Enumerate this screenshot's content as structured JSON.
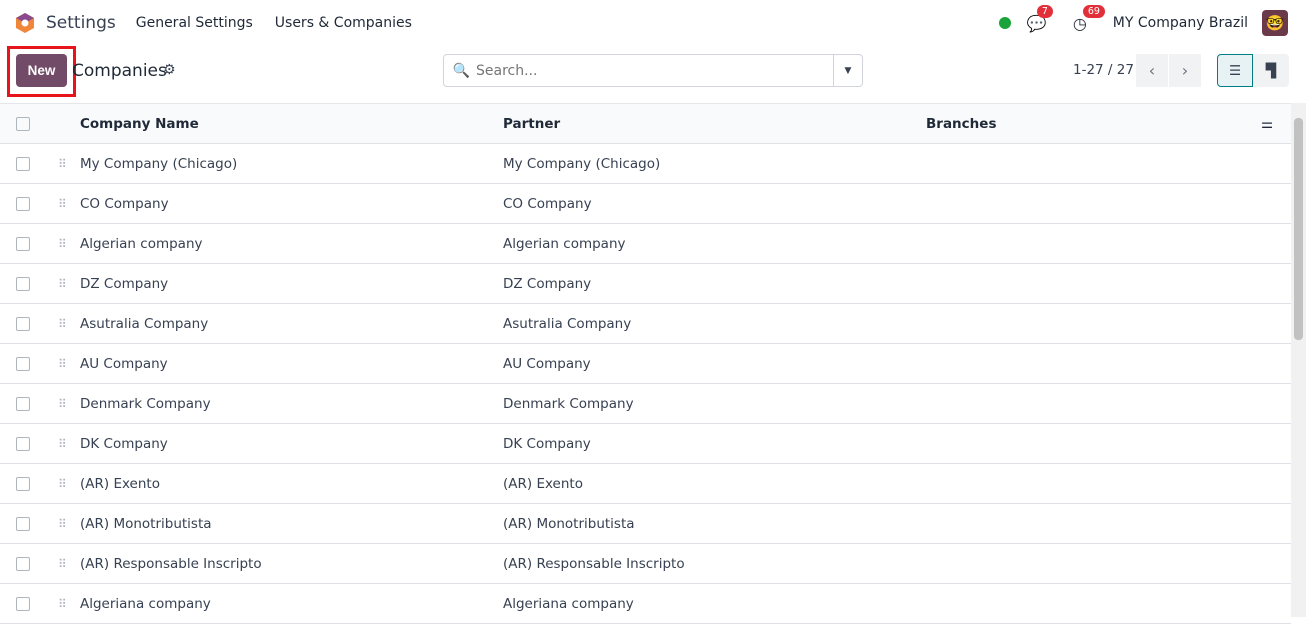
{
  "navbar": {
    "app": "Settings",
    "menus": [
      "General Settings",
      "Users & Companies"
    ],
    "messages_count": "7",
    "activities_count": "69",
    "company": "MY Company Brazil",
    "status_color": "#1aa33a"
  },
  "control": {
    "new_label": "New",
    "title": "Companies",
    "search_placeholder": "Search...",
    "pager": "1-27 / 27"
  },
  "table": {
    "headers": [
      "Company Name",
      "Partner",
      "Branches"
    ],
    "rows": [
      [
        "My Company (Chicago)",
        "My Company (Chicago)"
      ],
      [
        "CO Company",
        "CO Company"
      ],
      [
        "Algerian company",
        "Algerian company"
      ],
      [
        "DZ Company",
        "DZ Company"
      ],
      [
        "Asutralia Company",
        "Asutralia Company"
      ],
      [
        "AU Company",
        "AU Company"
      ],
      [
        "Denmark Company",
        "Denmark Company"
      ],
      [
        "DK Company",
        "DK Company"
      ],
      [
        "(AR) Exento",
        "(AR) Exento"
      ],
      [
        "(AR) Monotributista",
        "(AR) Monotributista"
      ],
      [
        "(AR) Responsable Inscripto",
        "(AR) Responsable Inscripto"
      ],
      [
        "Algeriana company",
        "Algeriana company"
      ]
    ]
  },
  "colors": {
    "brand": "#714b67",
    "highlight": "#e8141c"
  }
}
